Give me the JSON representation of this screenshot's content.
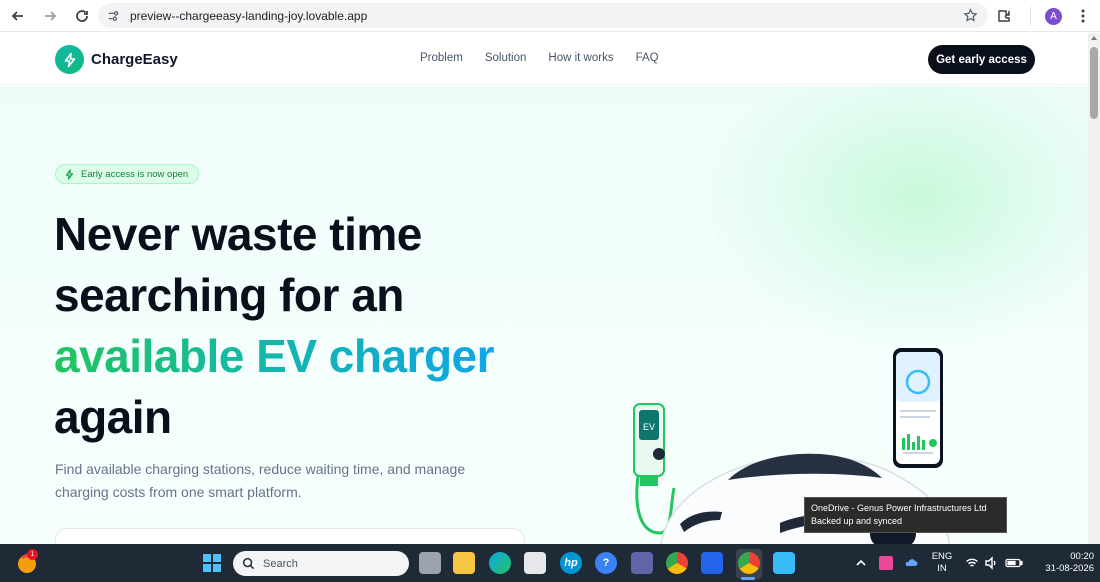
{
  "browser": {
    "url": "preview--chargeeasy-landing-joy.lovable.app",
    "profile_initial": "A",
    "icons": [
      "back-icon",
      "forward-icon",
      "reload-icon",
      "site-info-icon",
      "bookmark-star-icon",
      "extensions-icon",
      "menu-icon"
    ]
  },
  "site": {
    "brand": "ChargeEasy",
    "nav": [
      "Problem",
      "Solution",
      "How it works",
      "FAQ"
    ],
    "cta": "Get early access",
    "badge": "Early access is now open",
    "headline": {
      "line1": "Never waste time",
      "line2": "searching for an",
      "line3_gradient": "available EV charger",
      "line4": "again"
    },
    "subheadline": "Find available charging stations, reduce waiting time, and manage charging costs from one smart platform.",
    "colors": {
      "accent_green": "#22c55e",
      "accent_teal": "#14b8a6",
      "accent_blue": "#0ea5e9",
      "cta_bg": "#0a0f1c"
    },
    "illustration": {
      "charger_label": "EV"
    }
  },
  "notification": {
    "title": "OneDrive - Genus Power Infrastructures Ltd",
    "body": "Backed up and synced"
  },
  "taskbar": {
    "search_placeholder": "Search",
    "notification_count": "1",
    "language": "ENG",
    "region": "IN",
    "time": "00:20",
    "date": "31-08-2026"
  }
}
